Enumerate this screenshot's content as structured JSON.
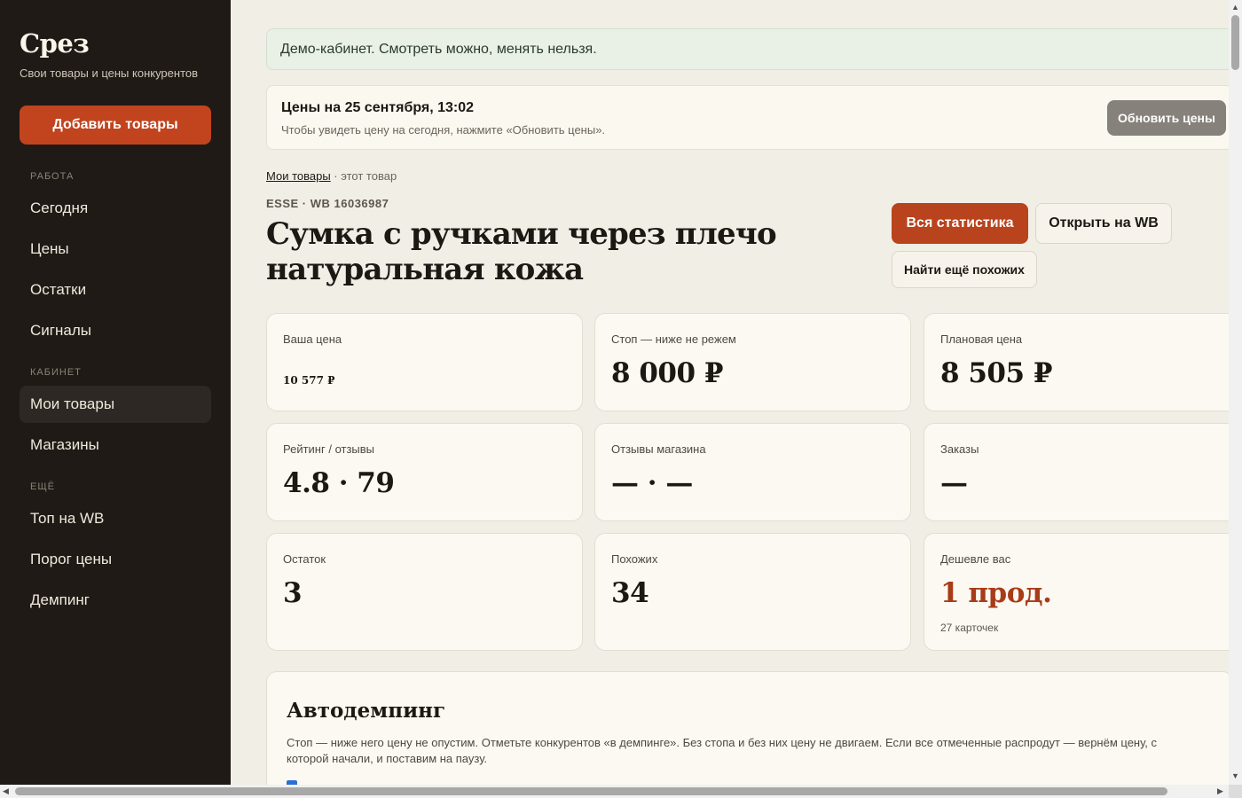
{
  "sidebar": {
    "brand": "Срез",
    "tagline": "Свои товары и цены конкурентов",
    "add_button": "Добавить товары",
    "sections": [
      {
        "title": "РАБОТА",
        "items": [
          {
            "label": "Сегодня"
          },
          {
            "label": "Цены"
          },
          {
            "label": "Остатки"
          },
          {
            "label": "Сигналы"
          }
        ]
      },
      {
        "title": "КАБИНЕТ",
        "items": [
          {
            "label": "Мои товары",
            "active": true
          },
          {
            "label": "Магазины"
          }
        ]
      },
      {
        "title": "ЕЩЁ",
        "items": [
          {
            "label": "Топ на WB"
          },
          {
            "label": "Порог цены"
          },
          {
            "label": "Демпинг"
          }
        ]
      }
    ]
  },
  "banner": {
    "text": "Демо-кабинет. Смотреть можно, менять нельзя."
  },
  "prices_bar": {
    "title": "Цены на 25 сентября, 13:02",
    "subtitle": "Чтобы увидеть цену на сегодня, нажмите «Обновить цены».",
    "refresh_button": "Обновить цены"
  },
  "breadcrumb": {
    "link": "Мои товары",
    "separator": " · ",
    "current": "этот товар"
  },
  "product": {
    "sku": "ESSE · WB 16036987",
    "title": "Сумка с ручками через плечо натуральная кожа",
    "btn_stats": "Вся статистика",
    "btn_open_wb": "Открыть на WB",
    "btn_similar": "Найти ещё похожих"
  },
  "cards": [
    {
      "label": "Ваша цена",
      "value": "10 577 ₽"
    },
    {
      "label": "Стоп — ниже не режем",
      "value": "8 000 ₽"
    },
    {
      "label": "Плановая цена",
      "value": "8 505 ₽"
    },
    {
      "label": "Рейтинг / отзывы",
      "value": "4.8 · 79"
    },
    {
      "label": "Отзывы магазина",
      "value": "— · —"
    },
    {
      "label": "Заказы",
      "value": "—"
    },
    {
      "label": "Остаток",
      "value": "3"
    },
    {
      "label": "Похожих",
      "value": "34"
    },
    {
      "label": "Дешевле вас",
      "value": "1 прод.",
      "note": "27 карточек"
    }
  ],
  "autodump": {
    "title": "Автодемпинг",
    "text": "Стоп — ниже него цену не опустим. Отметьте конкурентов «в демпинге». Без стопа и без них цену не двигаем. Если все отмеченные распродут — вернём цену, с которой начали, и поставим на паузу."
  },
  "colors": {
    "sidebar_bg": "#1f1a16",
    "accent": "#c1441f",
    "page_bg": "#f1eee6"
  }
}
